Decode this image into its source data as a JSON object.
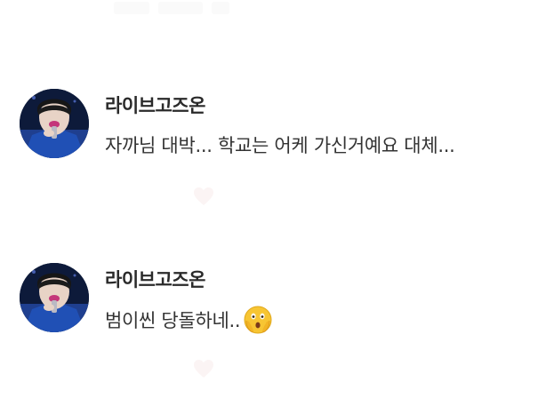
{
  "comments": [
    {
      "author": "라이브고즈온",
      "text": "자까님 대박... 학교는 어케 가신거예요 대체..."
    },
    {
      "author": "라이브고즈온",
      "text": "범이씬 당돌하네..",
      "emoji": "shocked-face-emoji"
    }
  ],
  "icons": {
    "like": "heart-icon"
  },
  "colors": {
    "text": "#333333",
    "author": "#2a2a2a",
    "avatar_bg": "#0d1a3a",
    "avatar_accent": "#c4367a"
  }
}
